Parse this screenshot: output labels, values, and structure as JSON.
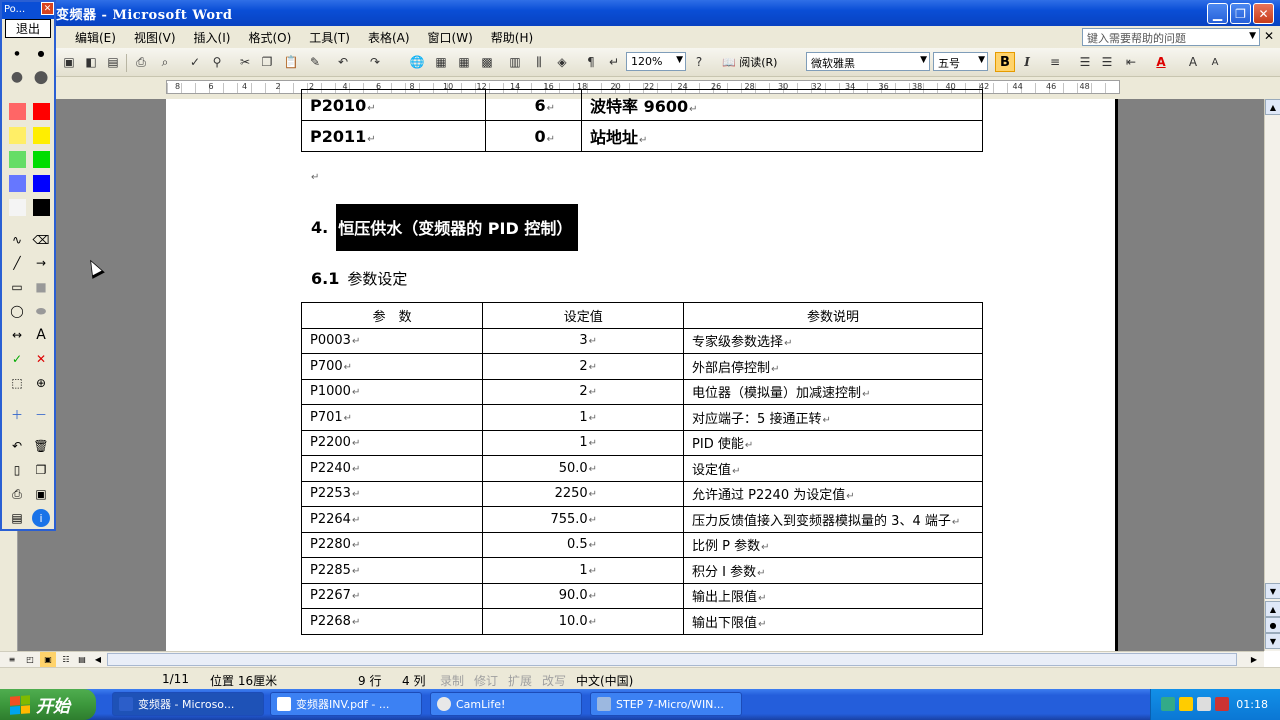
{
  "window": {
    "title": "变频器 - Microsoft Word"
  },
  "menu": {
    "items": [
      "编辑(E)",
      "视图(V)",
      "插入(I)",
      "格式(O)",
      "工具(T)",
      "表格(A)",
      "窗口(W)",
      "帮助(H)"
    ],
    "help_placeholder": "键入需要帮助的问题"
  },
  "toolbar": {
    "zoom": "120%",
    "read_label": "阅读(R)",
    "font": "微软雅黑",
    "size": "五号",
    "bold_label": "B",
    "italic_label": "I",
    "font_color_label": "A"
  },
  "ruler": {
    "marks": [
      "8",
      "6",
      "4",
      "2",
      "2",
      "4",
      "6",
      "8",
      "10",
      "12",
      "14",
      "16",
      "18",
      "20",
      "22",
      "24",
      "26",
      "28",
      "30",
      "32",
      "34",
      "36",
      "38",
      "40",
      "42",
      "44",
      "46",
      "48"
    ]
  },
  "pen_toolbox": {
    "title": "Po...",
    "exit_label": "退出"
  },
  "document": {
    "top_table": [
      {
        "param": "P2010",
        "value": "6",
        "desc": "波特率 9600"
      },
      {
        "param": "P2011",
        "value": "0",
        "desc": "站地址"
      }
    ],
    "heading4": {
      "number": "4.",
      "text": "恒压供水（变频器的 PID 控制）"
    },
    "heading61": {
      "number": "6.1",
      "text": "参数设定"
    },
    "table_headers": [
      "参　数",
      "设定值",
      "参数说明"
    ],
    "table_rows": [
      {
        "param": "P0003",
        "value": "3",
        "desc": "专家级参数选择"
      },
      {
        "param": "P700",
        "value": "2",
        "desc": "外部启停控制"
      },
      {
        "param": "P1000",
        "value": "2",
        "desc": "电位器（模拟量）加减速控制"
      },
      {
        "param": "P701",
        "value": "1",
        "desc": "对应端子：5 接通正转"
      },
      {
        "param": "P2200",
        "value": "1",
        "desc": "PID 使能"
      },
      {
        "param": "P2240",
        "value": "50.0",
        "desc": "设定值"
      },
      {
        "param": "P2253",
        "value": "2250",
        "desc": "允许通过 P2240 为设定值"
      },
      {
        "param": "P2264",
        "value": "755.0",
        "desc": "压力反馈值接入到变频器模拟量的 3、4 端子"
      },
      {
        "param": "P2280",
        "value": "0.5",
        "desc": "比例 P 参数"
      },
      {
        "param": "P2285",
        "value": "1",
        "desc": "积分 I 参数"
      },
      {
        "param": "P2267",
        "value": "90.0",
        "desc": "输出上限值"
      },
      {
        "param": "P2268",
        "value": "10.0",
        "desc": "输出下限值"
      }
    ]
  },
  "status": {
    "page": "1/11",
    "position": "位置 16厘米",
    "line": "9 行",
    "col": "4 列",
    "rec": "录制",
    "trk": "修订",
    "ext": "扩展",
    "ovr": "改写",
    "lang": "中文(中国)"
  },
  "taskbar": {
    "start_label": "开始",
    "items": [
      "变频器 - Microso...",
      "变频器INV.pdf - ...",
      "CamLife!",
      "STEP 7-Micro/WIN..."
    ],
    "clock": "01:18"
  },
  "colors": {
    "titlebar": "#0a4ed6",
    "taskbar": "#245edb",
    "start": "#3c983c",
    "bold_active": "#ffd36b"
  }
}
